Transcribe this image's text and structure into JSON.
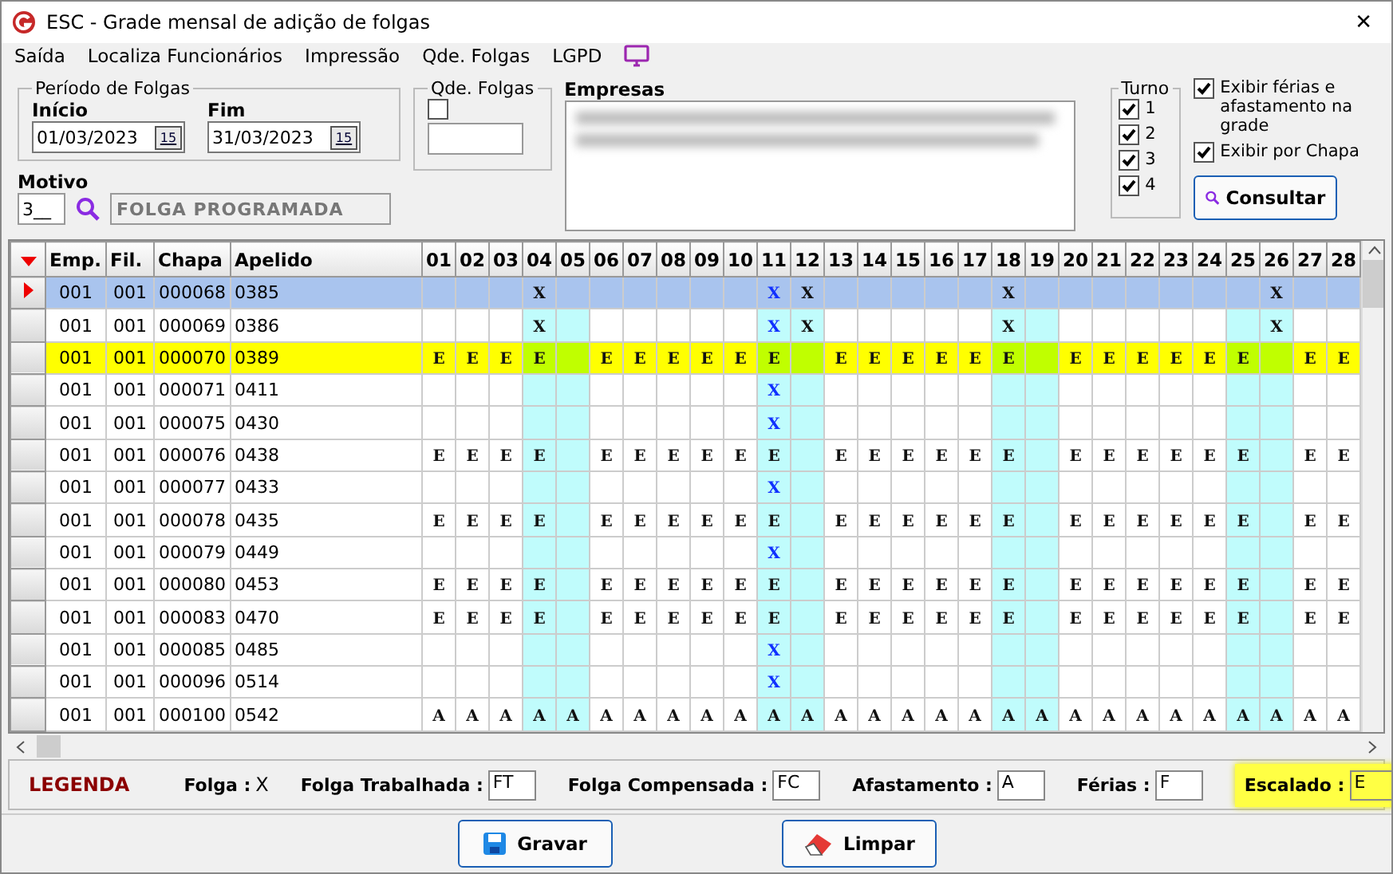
{
  "window": {
    "title": "ESC - Grade mensal de adição de folgas",
    "close": "✕"
  },
  "menu": [
    "Saída",
    "Localiza Funcionários",
    "Impressão",
    "Qde. Folgas",
    "LGPD"
  ],
  "periodo": {
    "legend": "Período de Folgas",
    "inicio_label": "Início",
    "inicio": "01/03/2023",
    "inicio_calendar": "15",
    "fim_label": "Fim",
    "fim": "31/03/2023",
    "fim_calendar": "15"
  },
  "qde_folgas": {
    "legend": "Qde. Folgas",
    "checked": false
  },
  "motivo": {
    "label": "Motivo",
    "code": "3__",
    "description": "FOLGA PROGRAMADA"
  },
  "empresas": {
    "label": "Empresas"
  },
  "turno": {
    "legend": "Turno",
    "items": [
      {
        "label": "1",
        "checked": true
      },
      {
        "label": "2",
        "checked": true
      },
      {
        "label": "3",
        "checked": true
      },
      {
        "label": "4",
        "checked": true
      }
    ]
  },
  "options": [
    {
      "label": "Exibir férias e afastamento na grade",
      "checked": true
    },
    {
      "label": "Exibir por Chapa",
      "checked": true
    }
  ],
  "consultar": "Consultar",
  "table": {
    "columns": [
      "Emp.",
      "Fil.",
      "Chapa",
      "Apelido"
    ],
    "days": [
      {
        "label": "01",
        "weekend": false
      },
      {
        "label": "02",
        "weekend": false
      },
      {
        "label": "03",
        "weekend": false
      },
      {
        "label": "04",
        "weekend": true
      },
      {
        "label": "05",
        "weekend": true
      },
      {
        "label": "06",
        "weekend": false
      },
      {
        "label": "07",
        "weekend": false
      },
      {
        "label": "08",
        "weekend": false
      },
      {
        "label": "09",
        "weekend": false
      },
      {
        "label": "10",
        "weekend": false
      },
      {
        "label": "11",
        "weekend": true
      },
      {
        "label": "12",
        "weekend": true
      },
      {
        "label": "13",
        "weekend": false
      },
      {
        "label": "14",
        "weekend": false
      },
      {
        "label": "15",
        "weekend": false
      },
      {
        "label": "16",
        "weekend": false
      },
      {
        "label": "17",
        "weekend": false
      },
      {
        "label": "18",
        "weekend": true
      },
      {
        "label": "19",
        "weekend": true
      },
      {
        "label": "20",
        "weekend": false
      },
      {
        "label": "21",
        "weekend": false
      },
      {
        "label": "22",
        "weekend": false
      },
      {
        "label": "23",
        "weekend": false
      },
      {
        "label": "24",
        "weekend": false
      },
      {
        "label": "25",
        "weekend": true
      },
      {
        "label": "26",
        "weekend": true
      },
      {
        "label": "27",
        "weekend": false
      },
      {
        "label": "28",
        "weekend": false
      }
    ],
    "rows": [
      {
        "emp": "001",
        "fil": "001",
        "chapa": "000068",
        "apelido": "0385",
        "selected": true,
        "highlighted": false,
        "days": [
          {
            "kind": "blank"
          },
          {
            "kind": "blank"
          },
          {
            "kind": "blank"
          },
          {
            "kind": "saved",
            "text": "X"
          },
          {
            "kind": "blank"
          },
          {
            "kind": "blank"
          },
          {
            "kind": "blank"
          },
          {
            "kind": "blank"
          },
          {
            "kind": "blank"
          },
          {
            "kind": "blank"
          },
          {
            "kind": "added",
            "text": "X"
          },
          {
            "kind": "saved",
            "text": "X"
          },
          {
            "kind": "blank"
          },
          {
            "kind": "blank"
          },
          {
            "kind": "blank"
          },
          {
            "kind": "blank"
          },
          {
            "kind": "blank"
          },
          {
            "kind": "saved",
            "text": "X"
          },
          {
            "kind": "blank"
          },
          {
            "kind": "blank"
          },
          {
            "kind": "blank"
          },
          {
            "kind": "blank"
          },
          {
            "kind": "blank"
          },
          {
            "kind": "blank"
          },
          {
            "kind": "blank"
          },
          {
            "kind": "saved",
            "text": "X"
          },
          {
            "kind": "blank"
          },
          {
            "kind": "blank"
          }
        ]
      },
      {
        "emp": "001",
        "fil": "001",
        "chapa": "000069",
        "apelido": "0386",
        "selected": false,
        "highlighted": false,
        "days": [
          {
            "kind": "blank"
          },
          {
            "kind": "blank"
          },
          {
            "kind": "blank"
          },
          {
            "kind": "saved",
            "text": "X"
          },
          {
            "kind": "blank"
          },
          {
            "kind": "blank"
          },
          {
            "kind": "blank"
          },
          {
            "kind": "blank"
          },
          {
            "kind": "blank"
          },
          {
            "kind": "blank"
          },
          {
            "kind": "added",
            "text": "X"
          },
          {
            "kind": "saved",
            "text": "X"
          },
          {
            "kind": "blank"
          },
          {
            "kind": "blank"
          },
          {
            "kind": "blank"
          },
          {
            "kind": "blank"
          },
          {
            "kind": "blank"
          },
          {
            "kind": "saved",
            "text": "X"
          },
          {
            "kind": "blank"
          },
          {
            "kind": "blank"
          },
          {
            "kind": "blank"
          },
          {
            "kind": "blank"
          },
          {
            "kind": "blank"
          },
          {
            "kind": "blank"
          },
          {
            "kind": "blank"
          },
          {
            "kind": "saved",
            "text": "X"
          },
          {
            "kind": "blank"
          },
          {
            "kind": "blank"
          }
        ]
      },
      {
        "emp": "001",
        "fil": "001",
        "chapa": "000070",
        "apelido": "0389",
        "selected": false,
        "highlighted": true,
        "days": [
          {
            "kind": "saved",
            "text": "E"
          },
          {
            "kind": "saved",
            "text": "E"
          },
          {
            "kind": "saved",
            "text": "E"
          },
          {
            "kind": "saved",
            "text": "E"
          },
          {
            "kind": "blank"
          },
          {
            "kind": "saved",
            "text": "E"
          },
          {
            "kind": "saved",
            "text": "E"
          },
          {
            "kind": "saved",
            "text": "E"
          },
          {
            "kind": "saved",
            "text": "E"
          },
          {
            "kind": "saved",
            "text": "E"
          },
          {
            "kind": "saved",
            "text": "E"
          },
          {
            "kind": "blank"
          },
          {
            "kind": "saved",
            "text": "E"
          },
          {
            "kind": "saved",
            "text": "E"
          },
          {
            "kind": "saved",
            "text": "E"
          },
          {
            "kind": "saved",
            "text": "E"
          },
          {
            "kind": "saved",
            "text": "E"
          },
          {
            "kind": "saved",
            "text": "E"
          },
          {
            "kind": "blank"
          },
          {
            "kind": "saved",
            "text": "E"
          },
          {
            "kind": "saved",
            "text": "E"
          },
          {
            "kind": "saved",
            "text": "E"
          },
          {
            "kind": "saved",
            "text": "E"
          },
          {
            "kind": "saved",
            "text": "E"
          },
          {
            "kind": "saved",
            "text": "E"
          },
          {
            "kind": "blank"
          },
          {
            "kind": "saved",
            "text": "E"
          },
          {
            "kind": "saved",
            "text": "E"
          }
        ]
      },
      {
        "emp": "001",
        "fil": "001",
        "chapa": "000071",
        "apelido": "0411",
        "selected": false,
        "highlighted": false,
        "days": [
          {
            "kind": "blank"
          },
          {
            "kind": "blank"
          },
          {
            "kind": "blank"
          },
          {
            "kind": "blank"
          },
          {
            "kind": "blank"
          },
          {
            "kind": "blank"
          },
          {
            "kind": "blank"
          },
          {
            "kind": "blank"
          },
          {
            "kind": "blank"
          },
          {
            "kind": "blank"
          },
          {
            "kind": "added",
            "text": "X"
          },
          {
            "kind": "blank"
          },
          {
            "kind": "blank"
          },
          {
            "kind": "blank"
          },
          {
            "kind": "blank"
          },
          {
            "kind": "blank"
          },
          {
            "kind": "blank"
          },
          {
            "kind": "blank"
          },
          {
            "kind": "blank"
          },
          {
            "kind": "blank"
          },
          {
            "kind": "blank"
          },
          {
            "kind": "blank"
          },
          {
            "kind": "blank"
          },
          {
            "kind": "blank"
          },
          {
            "kind": "blank"
          },
          {
            "kind": "blank"
          },
          {
            "kind": "blank"
          },
          {
            "kind": "blank"
          }
        ]
      },
      {
        "emp": "001",
        "fil": "001",
        "chapa": "000075",
        "apelido": "0430",
        "selected": false,
        "highlighted": false,
        "days": [
          {
            "kind": "blank"
          },
          {
            "kind": "blank"
          },
          {
            "kind": "blank"
          },
          {
            "kind": "blank"
          },
          {
            "kind": "blank"
          },
          {
            "kind": "blank"
          },
          {
            "kind": "blank"
          },
          {
            "kind": "blank"
          },
          {
            "kind": "blank"
          },
          {
            "kind": "blank"
          },
          {
            "kind": "added",
            "text": "X"
          },
          {
            "kind": "blank"
          },
          {
            "kind": "blank"
          },
          {
            "kind": "blank"
          },
          {
            "kind": "blank"
          },
          {
            "kind": "blank"
          },
          {
            "kind": "blank"
          },
          {
            "kind": "blank"
          },
          {
            "kind": "blank"
          },
          {
            "kind": "blank"
          },
          {
            "kind": "blank"
          },
          {
            "kind": "blank"
          },
          {
            "kind": "blank"
          },
          {
            "kind": "blank"
          },
          {
            "kind": "blank"
          },
          {
            "kind": "blank"
          },
          {
            "kind": "blank"
          },
          {
            "kind": "blank"
          }
        ]
      },
      {
        "emp": "001",
        "fil": "001",
        "chapa": "000076",
        "apelido": "0438",
        "selected": false,
        "highlighted": false,
        "days": [
          {
            "kind": "saved",
            "text": "E"
          },
          {
            "kind": "saved",
            "text": "E"
          },
          {
            "kind": "saved",
            "text": "E"
          },
          {
            "kind": "saved",
            "text": "E"
          },
          {
            "kind": "blank"
          },
          {
            "kind": "saved",
            "text": "E"
          },
          {
            "kind": "saved",
            "text": "E"
          },
          {
            "kind": "saved",
            "text": "E"
          },
          {
            "kind": "saved",
            "text": "E"
          },
          {
            "kind": "saved",
            "text": "E"
          },
          {
            "kind": "saved",
            "text": "E"
          },
          {
            "kind": "blank"
          },
          {
            "kind": "saved",
            "text": "E"
          },
          {
            "kind": "saved",
            "text": "E"
          },
          {
            "kind": "saved",
            "text": "E"
          },
          {
            "kind": "saved",
            "text": "E"
          },
          {
            "kind": "saved",
            "text": "E"
          },
          {
            "kind": "saved",
            "text": "E"
          },
          {
            "kind": "blank"
          },
          {
            "kind": "saved",
            "text": "E"
          },
          {
            "kind": "saved",
            "text": "E"
          },
          {
            "kind": "saved",
            "text": "E"
          },
          {
            "kind": "saved",
            "text": "E"
          },
          {
            "kind": "saved",
            "text": "E"
          },
          {
            "kind": "saved",
            "text": "E"
          },
          {
            "kind": "blank"
          },
          {
            "kind": "saved",
            "text": "E"
          },
          {
            "kind": "saved",
            "text": "E"
          }
        ]
      },
      {
        "emp": "001",
        "fil": "001",
        "chapa": "000077",
        "apelido": "0433",
        "selected": false,
        "highlighted": false,
        "days": [
          {
            "kind": "blank"
          },
          {
            "kind": "blank"
          },
          {
            "kind": "blank"
          },
          {
            "kind": "blank"
          },
          {
            "kind": "blank"
          },
          {
            "kind": "blank"
          },
          {
            "kind": "blank"
          },
          {
            "kind": "blank"
          },
          {
            "kind": "blank"
          },
          {
            "kind": "blank"
          },
          {
            "kind": "added",
            "text": "X"
          },
          {
            "kind": "blank"
          },
          {
            "kind": "blank"
          },
          {
            "kind": "blank"
          },
          {
            "kind": "blank"
          },
          {
            "kind": "blank"
          },
          {
            "kind": "blank"
          },
          {
            "kind": "blank"
          },
          {
            "kind": "blank"
          },
          {
            "kind": "blank"
          },
          {
            "kind": "blank"
          },
          {
            "kind": "blank"
          },
          {
            "kind": "blank"
          },
          {
            "kind": "blank"
          },
          {
            "kind": "blank"
          },
          {
            "kind": "blank"
          },
          {
            "kind": "blank"
          },
          {
            "kind": "blank"
          }
        ]
      },
      {
        "emp": "001",
        "fil": "001",
        "chapa": "000078",
        "apelido": "0435",
        "selected": false,
        "highlighted": false,
        "days": [
          {
            "kind": "saved",
            "text": "E"
          },
          {
            "kind": "saved",
            "text": "E"
          },
          {
            "kind": "saved",
            "text": "E"
          },
          {
            "kind": "saved",
            "text": "E"
          },
          {
            "kind": "blank"
          },
          {
            "kind": "saved",
            "text": "E"
          },
          {
            "kind": "saved",
            "text": "E"
          },
          {
            "kind": "saved",
            "text": "E"
          },
          {
            "kind": "saved",
            "text": "E"
          },
          {
            "kind": "saved",
            "text": "E"
          },
          {
            "kind": "saved",
            "text": "E"
          },
          {
            "kind": "blank"
          },
          {
            "kind": "saved",
            "text": "E"
          },
          {
            "kind": "saved",
            "text": "E"
          },
          {
            "kind": "saved",
            "text": "E"
          },
          {
            "kind": "saved",
            "text": "E"
          },
          {
            "kind": "saved",
            "text": "E"
          },
          {
            "kind": "saved",
            "text": "E"
          },
          {
            "kind": "blank"
          },
          {
            "kind": "saved",
            "text": "E"
          },
          {
            "kind": "saved",
            "text": "E"
          },
          {
            "kind": "saved",
            "text": "E"
          },
          {
            "kind": "saved",
            "text": "E"
          },
          {
            "kind": "saved",
            "text": "E"
          },
          {
            "kind": "saved",
            "text": "E"
          },
          {
            "kind": "blank"
          },
          {
            "kind": "saved",
            "text": "E"
          },
          {
            "kind": "saved",
            "text": "E"
          }
        ]
      },
      {
        "emp": "001",
        "fil": "001",
        "chapa": "000079",
        "apelido": "0449",
        "selected": false,
        "highlighted": false,
        "days": [
          {
            "kind": "blank"
          },
          {
            "kind": "blank"
          },
          {
            "kind": "blank"
          },
          {
            "kind": "blank"
          },
          {
            "kind": "blank"
          },
          {
            "kind": "blank"
          },
          {
            "kind": "blank"
          },
          {
            "kind": "blank"
          },
          {
            "kind": "blank"
          },
          {
            "kind": "blank"
          },
          {
            "kind": "added",
            "text": "X"
          },
          {
            "kind": "blank"
          },
          {
            "kind": "blank"
          },
          {
            "kind": "blank"
          },
          {
            "kind": "blank"
          },
          {
            "kind": "blank"
          },
          {
            "kind": "blank"
          },
          {
            "kind": "blank"
          },
          {
            "kind": "blank"
          },
          {
            "kind": "blank"
          },
          {
            "kind": "blank"
          },
          {
            "kind": "blank"
          },
          {
            "kind": "blank"
          },
          {
            "kind": "blank"
          },
          {
            "kind": "blank"
          },
          {
            "kind": "blank"
          },
          {
            "kind": "blank"
          },
          {
            "kind": "blank"
          }
        ]
      },
      {
        "emp": "001",
        "fil": "001",
        "chapa": "000080",
        "apelido": "0453",
        "selected": false,
        "highlighted": false,
        "days": [
          {
            "kind": "saved",
            "text": "E"
          },
          {
            "kind": "saved",
            "text": "E"
          },
          {
            "kind": "saved",
            "text": "E"
          },
          {
            "kind": "saved",
            "text": "E"
          },
          {
            "kind": "blank"
          },
          {
            "kind": "saved",
            "text": "E"
          },
          {
            "kind": "saved",
            "text": "E"
          },
          {
            "kind": "saved",
            "text": "E"
          },
          {
            "kind": "saved",
            "text": "E"
          },
          {
            "kind": "saved",
            "text": "E"
          },
          {
            "kind": "saved",
            "text": "E"
          },
          {
            "kind": "blank"
          },
          {
            "kind": "saved",
            "text": "E"
          },
          {
            "kind": "saved",
            "text": "E"
          },
          {
            "kind": "saved",
            "text": "E"
          },
          {
            "kind": "saved",
            "text": "E"
          },
          {
            "kind": "saved",
            "text": "E"
          },
          {
            "kind": "saved",
            "text": "E"
          },
          {
            "kind": "blank"
          },
          {
            "kind": "saved",
            "text": "E"
          },
          {
            "kind": "saved",
            "text": "E"
          },
          {
            "kind": "saved",
            "text": "E"
          },
          {
            "kind": "saved",
            "text": "E"
          },
          {
            "kind": "saved",
            "text": "E"
          },
          {
            "kind": "saved",
            "text": "E"
          },
          {
            "kind": "blank"
          },
          {
            "kind": "saved",
            "text": "E"
          },
          {
            "kind": "saved",
            "text": "E"
          }
        ]
      },
      {
        "emp": "001",
        "fil": "001",
        "chapa": "000083",
        "apelido": "0470",
        "selected": false,
        "highlighted": false,
        "days": [
          {
            "kind": "saved",
            "text": "E"
          },
          {
            "kind": "saved",
            "text": "E"
          },
          {
            "kind": "saved",
            "text": "E"
          },
          {
            "kind": "saved",
            "text": "E"
          },
          {
            "kind": "blank"
          },
          {
            "kind": "saved",
            "text": "E"
          },
          {
            "kind": "saved",
            "text": "E"
          },
          {
            "kind": "saved",
            "text": "E"
          },
          {
            "kind": "saved",
            "text": "E"
          },
          {
            "kind": "saved",
            "text": "E"
          },
          {
            "kind": "saved",
            "text": "E"
          },
          {
            "kind": "blank"
          },
          {
            "kind": "saved",
            "text": "E"
          },
          {
            "kind": "saved",
            "text": "E"
          },
          {
            "kind": "saved",
            "text": "E"
          },
          {
            "kind": "saved",
            "text": "E"
          },
          {
            "kind": "saved",
            "text": "E"
          },
          {
            "kind": "saved",
            "text": "E"
          },
          {
            "kind": "blank"
          },
          {
            "kind": "saved",
            "text": "E"
          },
          {
            "kind": "saved",
            "text": "E"
          },
          {
            "kind": "saved",
            "text": "E"
          },
          {
            "kind": "saved",
            "text": "E"
          },
          {
            "kind": "saved",
            "text": "E"
          },
          {
            "kind": "saved",
            "text": "E"
          },
          {
            "kind": "blank"
          },
          {
            "kind": "saved",
            "text": "E"
          },
          {
            "kind": "saved",
            "text": "E"
          }
        ]
      },
      {
        "emp": "001",
        "fil": "001",
        "chapa": "000085",
        "apelido": "0485",
        "selected": false,
        "highlighted": false,
        "days": [
          {
            "kind": "blank"
          },
          {
            "kind": "blank"
          },
          {
            "kind": "blank"
          },
          {
            "kind": "blank"
          },
          {
            "kind": "blank"
          },
          {
            "kind": "blank"
          },
          {
            "kind": "blank"
          },
          {
            "kind": "blank"
          },
          {
            "kind": "blank"
          },
          {
            "kind": "blank"
          },
          {
            "kind": "added",
            "text": "X"
          },
          {
            "kind": "blank"
          },
          {
            "kind": "blank"
          },
          {
            "kind": "blank"
          },
          {
            "kind": "blank"
          },
          {
            "kind": "blank"
          },
          {
            "kind": "blank"
          },
          {
            "kind": "blank"
          },
          {
            "kind": "blank"
          },
          {
            "kind": "blank"
          },
          {
            "kind": "blank"
          },
          {
            "kind": "blank"
          },
          {
            "kind": "blank"
          },
          {
            "kind": "blank"
          },
          {
            "kind": "blank"
          },
          {
            "kind": "blank"
          },
          {
            "kind": "blank"
          },
          {
            "kind": "blank"
          }
        ]
      },
      {
        "emp": "001",
        "fil": "001",
        "chapa": "000096",
        "apelido": "0514",
        "selected": false,
        "highlighted": false,
        "days": [
          {
            "kind": "blank"
          },
          {
            "kind": "blank"
          },
          {
            "kind": "blank"
          },
          {
            "kind": "blank"
          },
          {
            "kind": "blank"
          },
          {
            "kind": "blank"
          },
          {
            "kind": "blank"
          },
          {
            "kind": "blank"
          },
          {
            "kind": "blank"
          },
          {
            "kind": "blank"
          },
          {
            "kind": "added",
            "text": "X"
          },
          {
            "kind": "blank"
          },
          {
            "kind": "blank"
          },
          {
            "kind": "blank"
          },
          {
            "kind": "blank"
          },
          {
            "kind": "blank"
          },
          {
            "kind": "blank"
          },
          {
            "kind": "blank"
          },
          {
            "kind": "blank"
          },
          {
            "kind": "blank"
          },
          {
            "kind": "blank"
          },
          {
            "kind": "blank"
          },
          {
            "kind": "blank"
          },
          {
            "kind": "blank"
          },
          {
            "kind": "blank"
          },
          {
            "kind": "blank"
          },
          {
            "kind": "blank"
          },
          {
            "kind": "blank"
          }
        ]
      },
      {
        "emp": "001",
        "fil": "001",
        "chapa": "000100",
        "apelido": "0542",
        "selected": false,
        "highlighted": false,
        "days": [
          {
            "kind": "saved",
            "text": "A"
          },
          {
            "kind": "saved",
            "text": "A"
          },
          {
            "kind": "saved",
            "text": "A"
          },
          {
            "kind": "saved",
            "text": "A"
          },
          {
            "kind": "saved",
            "text": "A"
          },
          {
            "kind": "saved",
            "text": "A"
          },
          {
            "kind": "saved",
            "text": "A"
          },
          {
            "kind": "saved",
            "text": "A"
          },
          {
            "kind": "saved",
            "text": "A"
          },
          {
            "kind": "saved",
            "text": "A"
          },
          {
            "kind": "saved",
            "text": "A"
          },
          {
            "kind": "saved",
            "text": "A"
          },
          {
            "kind": "saved",
            "text": "A"
          },
          {
            "kind": "saved",
            "text": "A"
          },
          {
            "kind": "saved",
            "text": "A"
          },
          {
            "kind": "saved",
            "text": "A"
          },
          {
            "kind": "saved",
            "text": "A"
          },
          {
            "kind": "saved",
            "text": "A"
          },
          {
            "kind": "saved",
            "text": "A"
          },
          {
            "kind": "saved",
            "text": "A"
          },
          {
            "kind": "saved",
            "text": "A"
          },
          {
            "kind": "saved",
            "text": "A"
          },
          {
            "kind": "saved",
            "text": "A"
          },
          {
            "kind": "saved",
            "text": "A"
          },
          {
            "kind": "saved",
            "text": "A"
          },
          {
            "kind": "saved",
            "text": "A"
          },
          {
            "kind": "saved",
            "text": "A"
          },
          {
            "kind": "saved",
            "text": "A"
          }
        ]
      }
    ]
  },
  "legend": {
    "title": "LEGENDA",
    "items": [
      {
        "label": "Folga :",
        "value": "X",
        "kind": "plain",
        "highlighted": false
      },
      {
        "label": "Folga Trabalhada :",
        "value": "FT",
        "kind": "field",
        "highlighted": false
      },
      {
        "label": "Folga Compensada :",
        "value": "FC",
        "kind": "field",
        "highlighted": false
      },
      {
        "label": "Afastamento :",
        "value": "A",
        "kind": "field",
        "highlighted": false
      },
      {
        "label": "Férias :",
        "value": "F",
        "kind": "field",
        "highlighted": false
      },
      {
        "label": "Escalado :",
        "value": "E",
        "kind": "field",
        "highlighted": true
      }
    ]
  },
  "buttons": [
    {
      "label": "Gravar",
      "kind": "save"
    },
    {
      "label": "Limpar",
      "kind": "clear"
    }
  ]
}
